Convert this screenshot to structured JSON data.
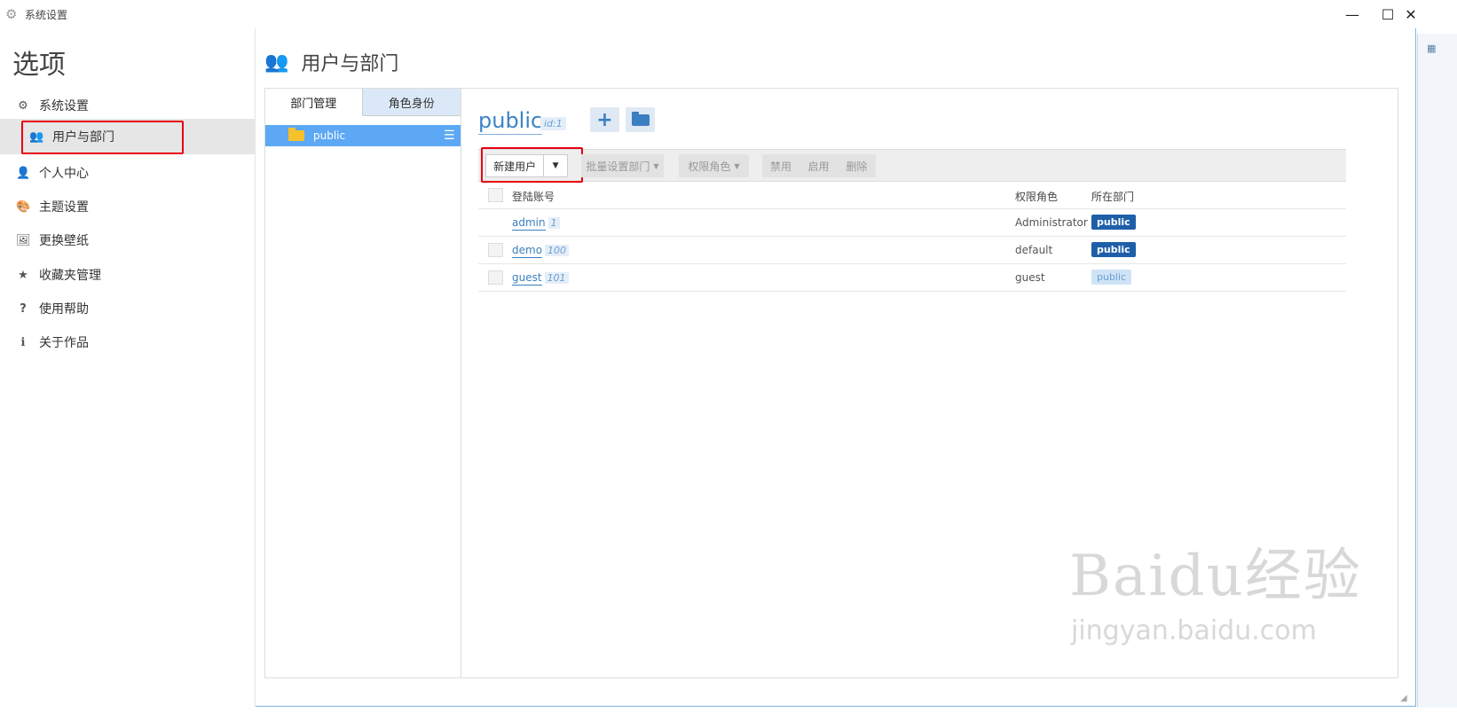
{
  "window": {
    "title": "系统设置",
    "controls": {
      "minimize": "—",
      "maximize": "☐",
      "close": "✕"
    }
  },
  "sidebar": {
    "heading": "选项",
    "items": [
      {
        "label": "系统设置",
        "icon": "gear-icon",
        "glyph": "⚙"
      },
      {
        "label": "用户与部门",
        "icon": "users-icon",
        "glyph": "👥",
        "active": true
      },
      {
        "label": "个人中心",
        "icon": "user-icon",
        "glyph": "👤"
      },
      {
        "label": "主题设置",
        "icon": "palette-icon",
        "glyph": "🎨"
      },
      {
        "label": "更换壁纸",
        "icon": "image-icon",
        "glyph": "🖼"
      },
      {
        "label": "收藏夹管理",
        "icon": "star-icon",
        "glyph": "★"
      },
      {
        "label": "使用帮助",
        "icon": "question-icon",
        "glyph": "?"
      },
      {
        "label": "关于作品",
        "icon": "info-icon",
        "glyph": "ℹ"
      }
    ]
  },
  "main": {
    "title": "用户与部门",
    "tabs": [
      {
        "label": "部门管理",
        "active": true
      },
      {
        "label": "角色身份",
        "active": false
      }
    ],
    "tree": {
      "selected": "public"
    },
    "dept": {
      "name": "public",
      "id": "id:1"
    },
    "toolbar": {
      "new_user": "新建用户",
      "batch_dept": "批量设置部门",
      "role": "权限角色",
      "disable": "禁用",
      "enable": "启用",
      "delete": "删除"
    },
    "table": {
      "columns": [
        "登陆账号",
        "权限角色",
        "所在部门"
      ],
      "rows": [
        {
          "account": "admin",
          "id": "1",
          "role": "Administrator",
          "dept": "public",
          "dept_style": "dark",
          "checkbox": false
        },
        {
          "account": "demo",
          "id": "100",
          "role": "default",
          "dept": "public",
          "dept_style": "dark",
          "checkbox": true
        },
        {
          "account": "guest",
          "id": "101",
          "role": "guest",
          "dept": "public",
          "dept_style": "light",
          "checkbox": true
        }
      ]
    }
  },
  "watermark": {
    "brand": "Baidu经验",
    "url": "jingyan.baidu.com"
  },
  "colors": {
    "accent": "#3a7fc1",
    "highlight": "#e60012",
    "tree_selected": "#5da8f5",
    "badge": "#1f5fa8"
  }
}
